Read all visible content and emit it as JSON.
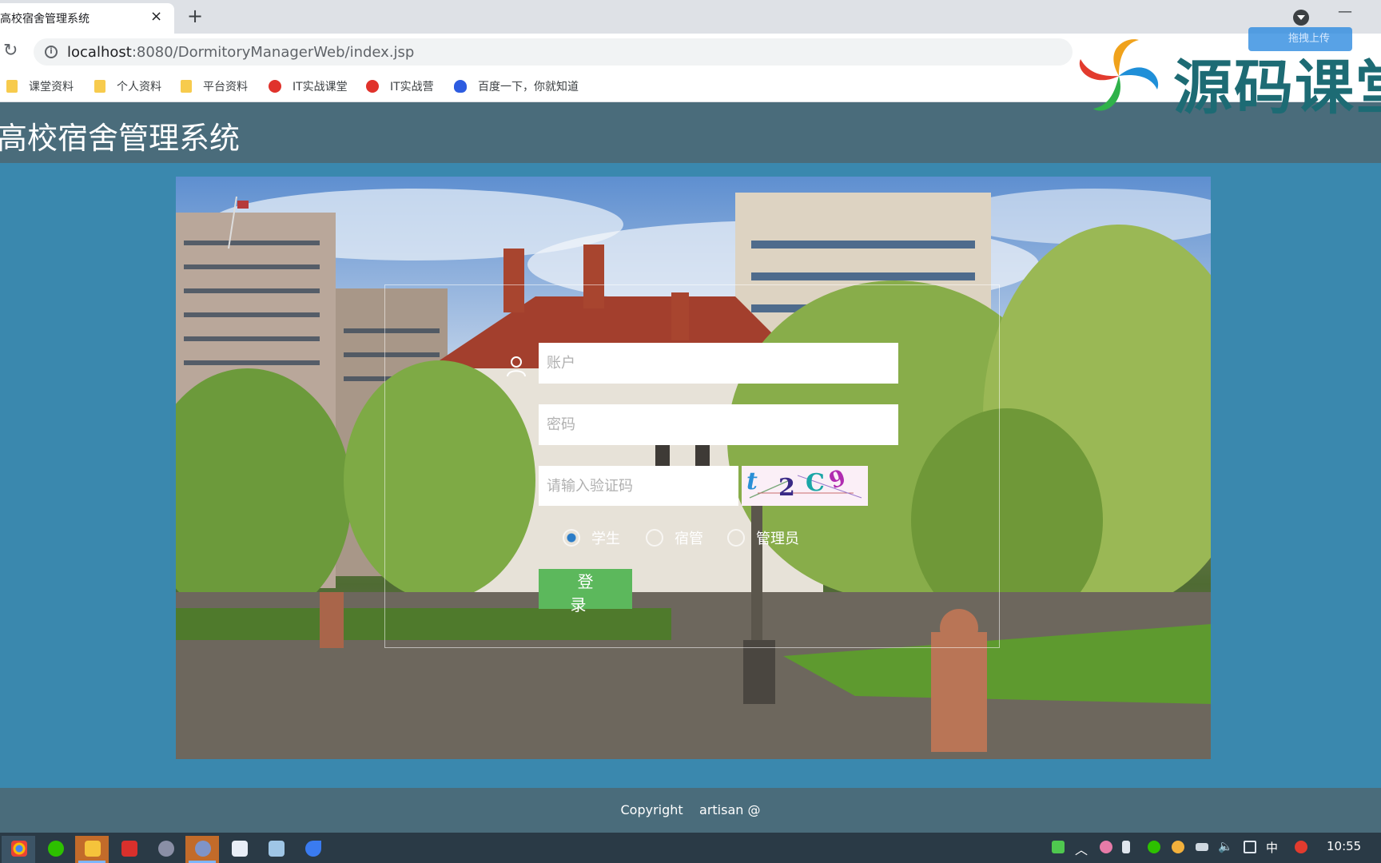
{
  "browser": {
    "tab_title": "高校宿舍管理系统",
    "tab_close": "×",
    "new_tab": "+",
    "url_host": "localhost",
    "url_rest": ":8080/DormitoryManagerWeb/index.jsp",
    "bookmarks": [
      {
        "label": "课堂资料",
        "icon": "folder-icon"
      },
      {
        "label": "个人资料",
        "icon": "folder-icon"
      },
      {
        "label": "平台资料",
        "icon": "folder-icon"
      },
      {
        "label": "IT实战课堂",
        "icon": "shield-icon"
      },
      {
        "label": "IT实战营",
        "icon": "shield-icon"
      },
      {
        "label": "百度一下，你就知道",
        "icon": "paw-icon"
      }
    ]
  },
  "watermark": {
    "text": "源码课堂",
    "upload_label": "拖拽上传"
  },
  "header": {
    "title": "高校宿舍管理系统"
  },
  "login": {
    "account_placeholder": "账户",
    "password_placeholder": "密码",
    "captcha_placeholder": "请输入验证码",
    "captcha_chars": [
      "t",
      "2",
      "C",
      "9"
    ],
    "roles": [
      {
        "label": "学生",
        "checked": true
      },
      {
        "label": "宿管",
        "checked": false
      },
      {
        "label": "管理员",
        "checked": false
      }
    ],
    "submit_label": "登 录"
  },
  "footer": {
    "copyright": "Copyright    artisan @"
  },
  "taskbar": {
    "clock": "10:55",
    "ime": "中"
  },
  "colors": {
    "page_bg": "#3a88ae",
    "header_bg": "#4a6c7b",
    "login_button": "#5cb85c"
  }
}
